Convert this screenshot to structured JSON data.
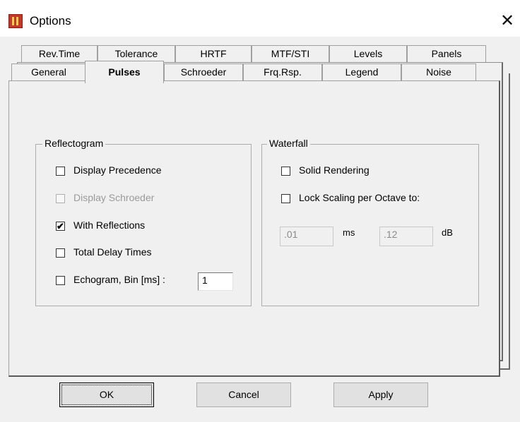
{
  "window": {
    "title": "Options",
    "close_glyph": "✕"
  },
  "tabs": {
    "row_back": [
      {
        "label": "Rev.Time"
      },
      {
        "label": "Tolerance"
      },
      {
        "label": "HRTF"
      },
      {
        "label": "MTF/STI"
      },
      {
        "label": "Levels"
      },
      {
        "label": "Panels"
      }
    ],
    "row_front": [
      {
        "label": "General"
      },
      {
        "label": "Pulses",
        "active": true
      },
      {
        "label": "Schroeder"
      },
      {
        "label": "Frq.Rsp."
      },
      {
        "label": "Legend"
      },
      {
        "label": "Noise"
      }
    ]
  },
  "reflectogram": {
    "legend": "Reflectogram",
    "items": [
      {
        "label": "Display Precedence",
        "checked": false,
        "enabled": true
      },
      {
        "label": "Display Schroeder",
        "checked": false,
        "enabled": false
      },
      {
        "label": "With Reflections",
        "checked": true,
        "enabled": true
      },
      {
        "label": "Total Delay Times",
        "checked": false,
        "enabled": true
      },
      {
        "label": "Echogram,  Bin [ms] :",
        "checked": false,
        "enabled": true
      }
    ],
    "bin_value": "1"
  },
  "waterfall": {
    "legend": "Waterfall",
    "items": [
      {
        "label": "Solid Rendering",
        "checked": false,
        "enabled": true
      },
      {
        "label": "Lock Scaling per Octave to:",
        "checked": false,
        "enabled": true
      }
    ],
    "ms_value": ".01",
    "ms_unit": "ms",
    "db_value": ".12",
    "db_unit": "dB"
  },
  "buttons": {
    "ok": "OK",
    "cancel": "Cancel",
    "apply": "Apply"
  },
  "colors": {
    "dialog_bg": "#f0f0f0",
    "disabled_text": "#9a9a9a",
    "icon_red": "#c0392b"
  },
  "check_glyph": "✔"
}
